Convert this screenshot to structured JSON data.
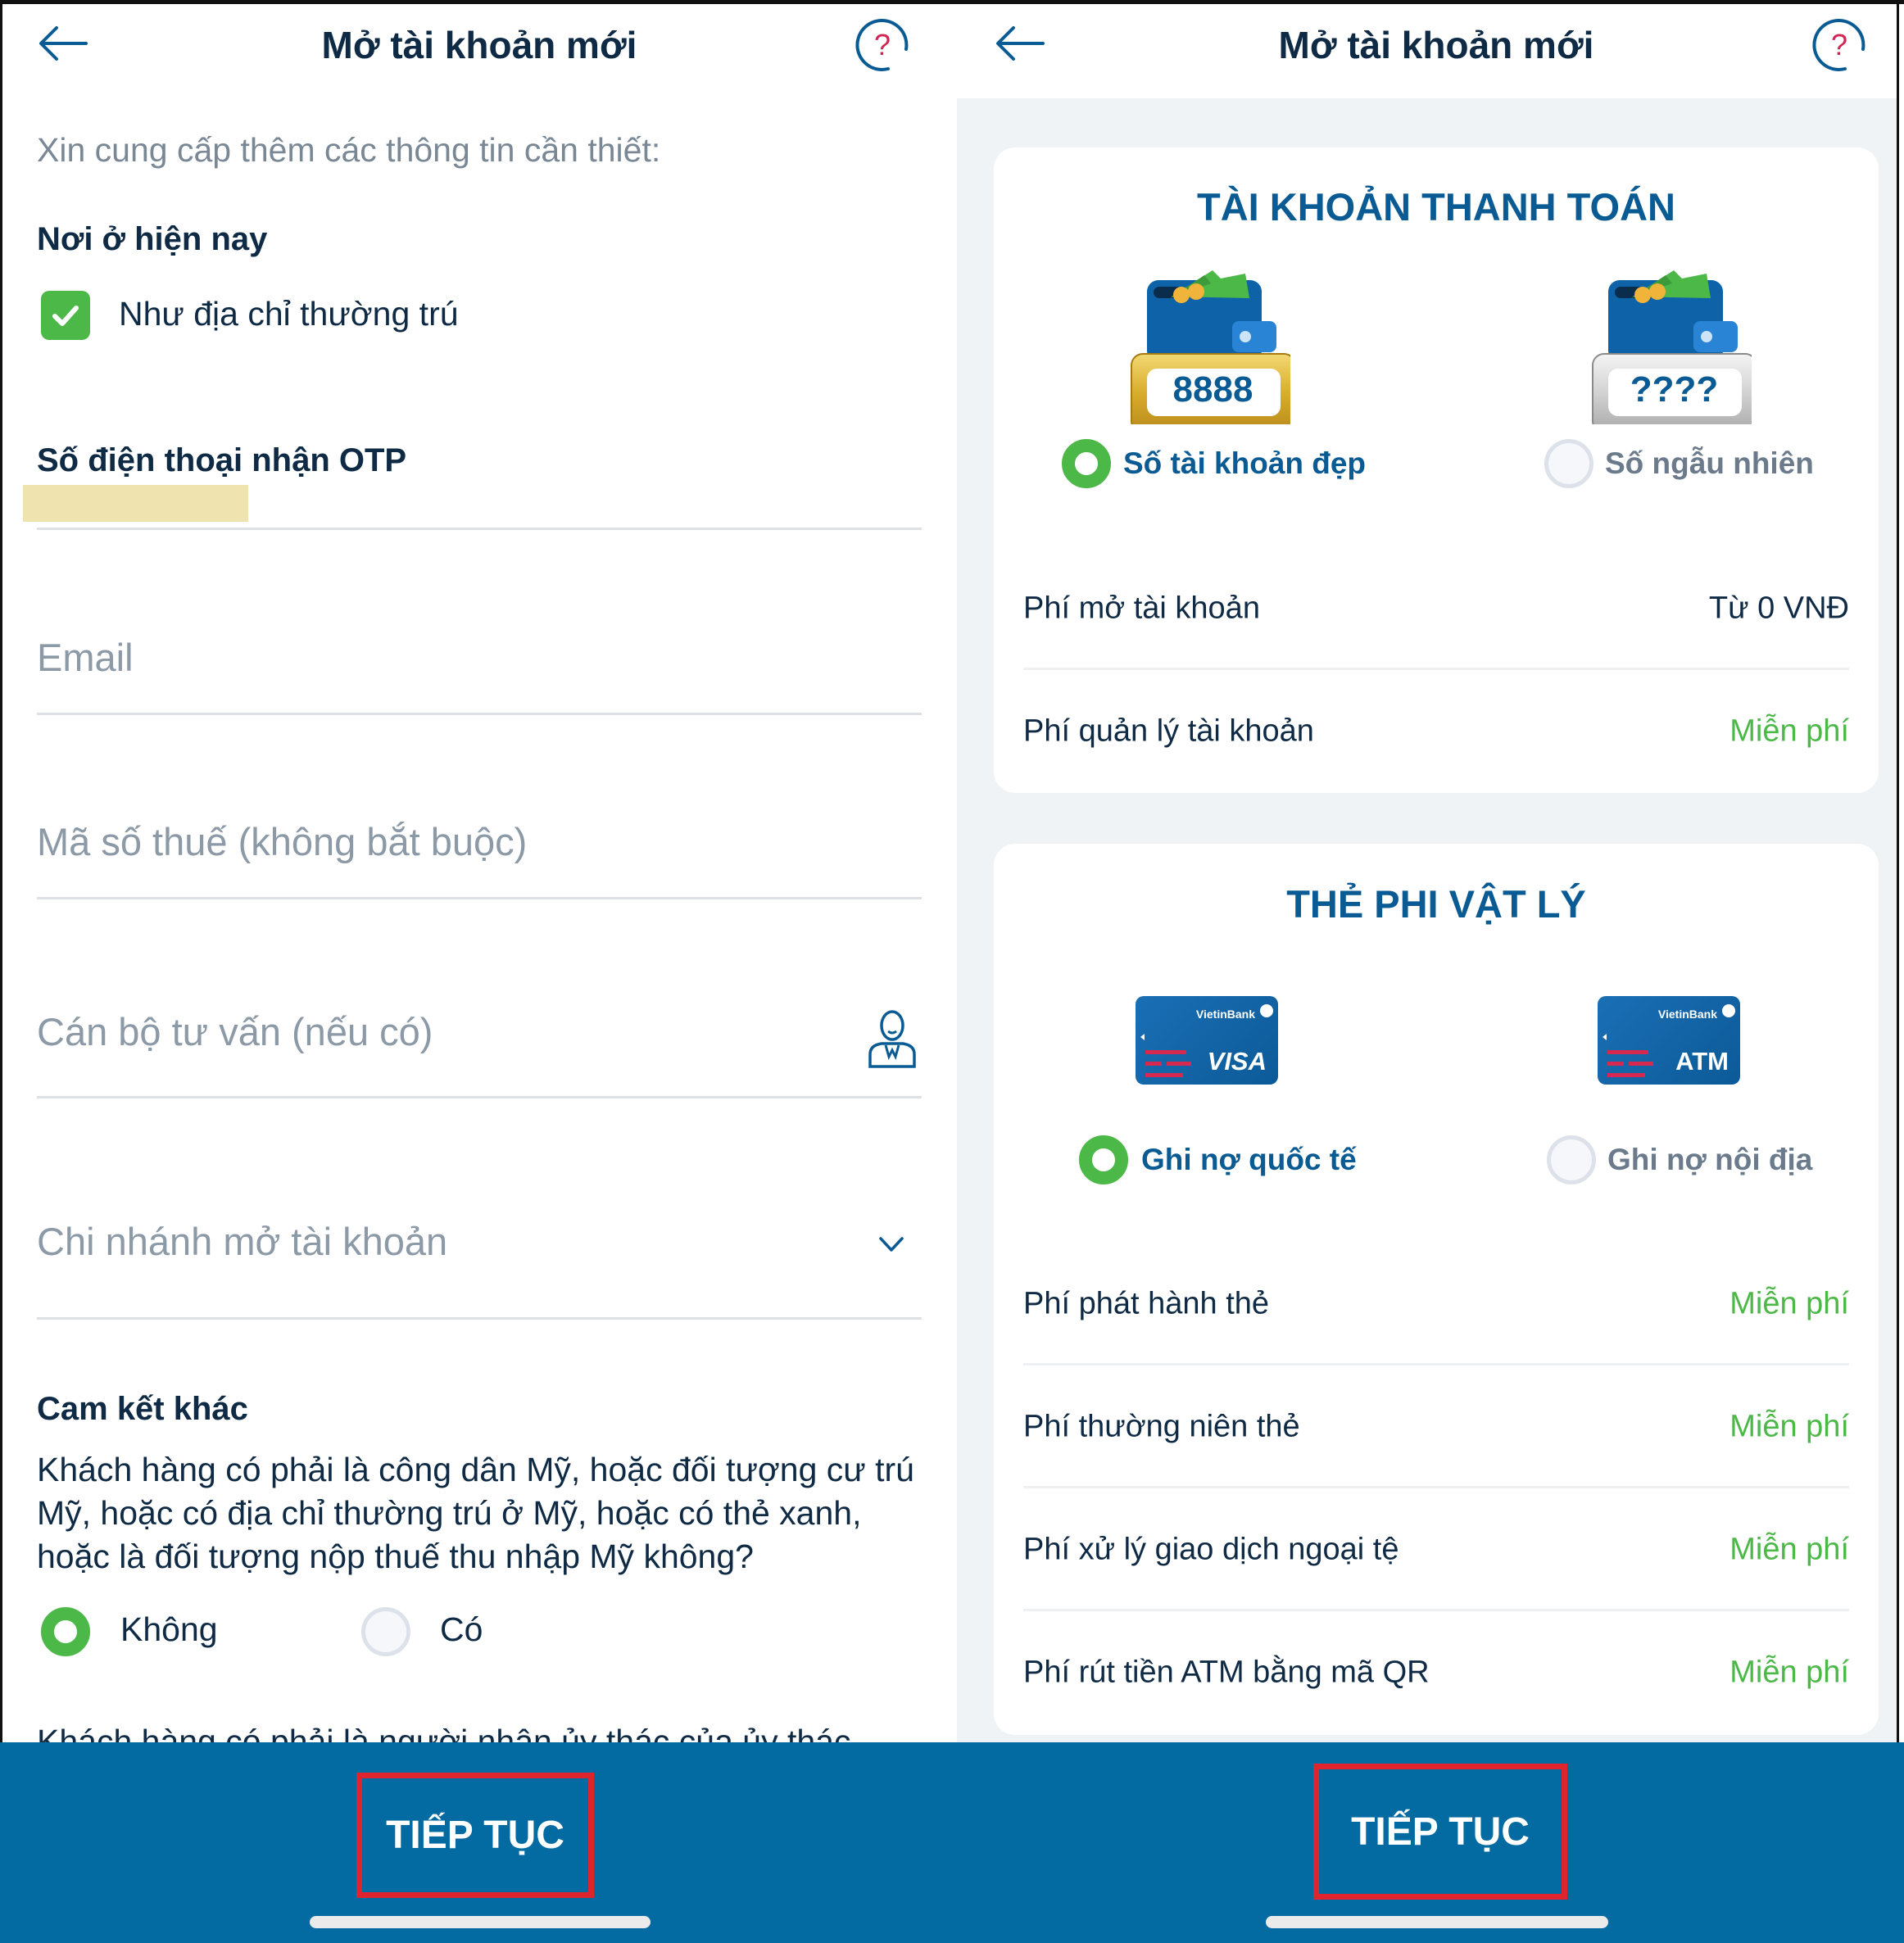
{
  "left_screen": {
    "header": {
      "title": "Mở tài khoản mới",
      "back_icon": "arrow-left-icon",
      "help_icon": "help-circle-icon"
    },
    "intro": "Xin cung cấp thêm các thông tin cần thiết:",
    "residence": {
      "title": "Nơi ở hiện nay",
      "checkbox_label": "Như địa chỉ thường trú",
      "checked": true
    },
    "otp_phone": {
      "label": "Số điện thoại nhận OTP",
      "value": ""
    },
    "email": {
      "placeholder": "Email"
    },
    "tax_code": {
      "placeholder": "Mã số thuế (không bắt buộc)"
    },
    "advisor": {
      "placeholder": "Cán bộ tư vấn (nếu có)",
      "icon": "advisor-person-icon"
    },
    "branch": {
      "placeholder": "Chi nhánh mở tài khoản",
      "icon": "chevron-down-icon"
    },
    "commitments": {
      "title": "Cam kết khác",
      "question1": "Khách hàng có phải là công dân Mỹ, hoặc đối tượng cư trú Mỹ, hoặc có địa chỉ thường trú ở Mỹ, hoặc có thẻ xanh, hoặc là đối tượng nộp thuế thu nhập Mỹ không?",
      "options": [
        {
          "label": "Không",
          "selected": true
        },
        {
          "label": "Có",
          "selected": false
        }
      ],
      "question2_partial": "Khách hàng có phải là người nhận ủy thác của ủy thác"
    },
    "continue_label": "TIẾP TỤC"
  },
  "right_screen": {
    "header": {
      "title": "Mở tài khoản mới",
      "back_icon": "arrow-left-icon",
      "help_icon": "help-circle-icon"
    },
    "payment_account": {
      "title": "TÀI KHOẢN THANH TOÁN",
      "options": [
        {
          "label": "Số tài khoản đẹp",
          "badge": "8888",
          "selected": true
        },
        {
          "label": "Số ngẫu nhiên",
          "badge": "????",
          "selected": false
        }
      ],
      "fees": [
        {
          "label": "Phí mở tài khoản",
          "value": "Từ 0 VNĐ"
        },
        {
          "label": "Phí quản lý tài khoản",
          "value": "Miễn phí"
        }
      ]
    },
    "physical_card": {
      "title": "THẺ PHI VẬT LÝ",
      "options": [
        {
          "label": "Ghi nợ quốc tế",
          "card_brand": "VietinBank",
          "card_type": "VISA",
          "selected": true
        },
        {
          "label": "Ghi nợ nội địa",
          "card_brand": "VietinBank",
          "card_type": "ATM",
          "selected": false
        }
      ],
      "fees": [
        {
          "label": "Phí phát hành thẻ",
          "value": "Miễn phí"
        },
        {
          "label": "Phí thường niên thẻ",
          "value": "Miễn phí"
        },
        {
          "label": "Phí xử lý giao dịch ngoại tệ",
          "value": "Miễn phí"
        },
        {
          "label": "Phí rút tiền ATM bằng mã QR",
          "value": "Miễn phí"
        }
      ]
    },
    "continue_label": "TIẾP TỤC"
  },
  "colors": {
    "primary_blue": "#046ba2",
    "title_blue": "#0a5b93",
    "success_green": "#4cb848",
    "highlight_red": "#e0242e",
    "panel_bg": "#eff3f6"
  }
}
